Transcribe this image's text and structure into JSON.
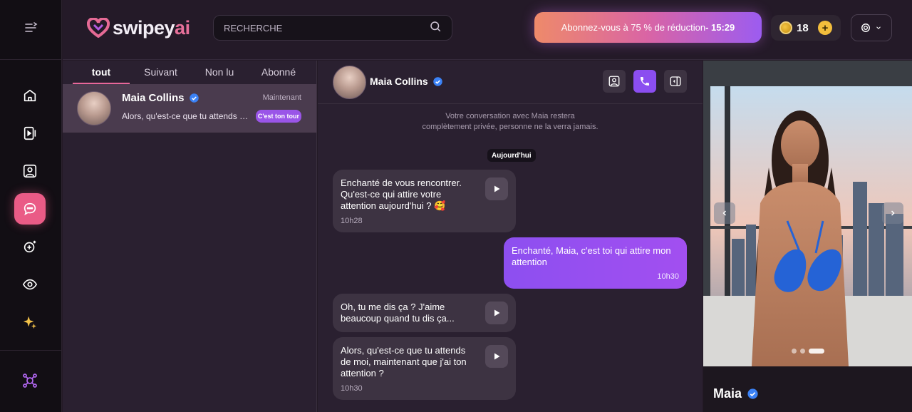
{
  "brand": {
    "name_main": "swipey",
    "name_accent": "ai"
  },
  "header": {
    "search_placeholder": "RECHERCHE",
    "promo_text": "Abonnez-vous à 75 % de réduction",
    "promo_timer": "- 15:29",
    "coins": "18",
    "coin_add": "+"
  },
  "sidebar": {
    "items": [
      {
        "icon": "home-icon"
      },
      {
        "icon": "video-icon"
      },
      {
        "icon": "gallery-icon"
      },
      {
        "icon": "chat-icon",
        "active": true
      },
      {
        "icon": "create-icon"
      },
      {
        "icon": "eye-icon"
      },
      {
        "icon": "sparkles-icon"
      },
      {
        "icon": "affiliate-icon"
      }
    ]
  },
  "conv_tabs": [
    "tout",
    "Suivant",
    "Non lu",
    "Abonné"
  ],
  "conversations": [
    {
      "name": "Maia Collins",
      "time": "Maintenant",
      "preview": "Alors, qu'est-ce que tu attends de moi, maintenant que j'ai ton attention ?",
      "badge": "C'est ton tour"
    }
  ],
  "chat": {
    "name": "Maia Collins",
    "privacy_line1": "Votre conversation avec Maia restera",
    "privacy_line2": "complètement privée, personne ne la verra jamais.",
    "day": "Aujourd'hui",
    "messages": [
      {
        "from": "ai",
        "text": "Enchanté de vous rencontrer. Qu'est-ce qui attire votre attention aujourd'hui ? 🥰",
        "time": "10h28"
      },
      {
        "from": "user",
        "text": "Enchanté, Maia, c'est toi qui attire mon attention",
        "time": "10h30"
      },
      {
        "from": "ai",
        "text": "Oh, tu me dis ça ? J'aime beaucoup quand tu dis ça...",
        "time": ""
      },
      {
        "from": "ai",
        "text": "Alors, qu'est-ce que tu attends de moi, maintenant que j'ai ton attention ?",
        "time": "10h30"
      }
    ]
  },
  "profile": {
    "name": "Maia"
  },
  "colors": {
    "accent_pink": "#ea5b86",
    "accent_purple": "#8d4ff0",
    "verified": "#3b82f6"
  }
}
